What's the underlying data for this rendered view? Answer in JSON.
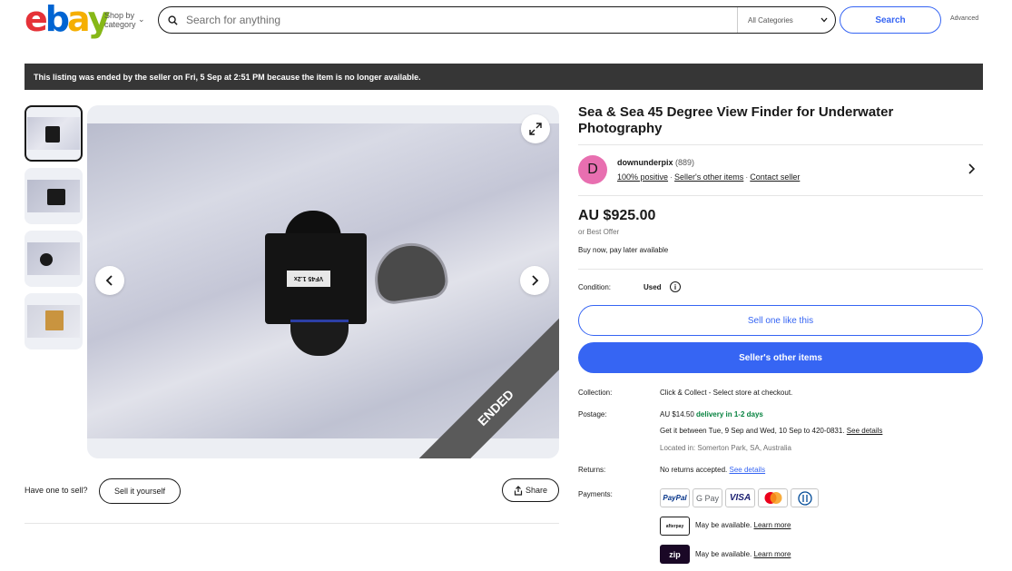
{
  "header": {
    "logo_letters": [
      "e",
      "b",
      "a",
      "y"
    ],
    "shop_by_category": "Shop by category",
    "search_placeholder": "Search for anything",
    "category_select": "All Categories",
    "search_button": "Search",
    "advanced": "Advanced"
  },
  "banner": {
    "text": "This listing was ended by the seller on Fri, 5 Sep at 2:51 PM because the item is no longer available."
  },
  "gallery": {
    "thumbnail_count": 4,
    "selected_index": 0,
    "ended_ribbon": "ENDED",
    "product_label_text": "VF45 1.2x"
  },
  "sell": {
    "have_one": "Have one to sell?",
    "sell_it_yourself": "Sell it yourself",
    "share": "Share"
  },
  "listing": {
    "title": "Sea & Sea 45 Degree View Finder for Underwater Photography",
    "seller": {
      "avatar_letter": "D",
      "name": "downunderpix",
      "feedback_count": "(889)",
      "positive": "100% positive",
      "other_items": "Seller's other items",
      "contact": "Contact seller"
    },
    "price": "AU $925.00",
    "best_offer": "or Best Offer",
    "pay_later": "Buy now, pay later available",
    "condition_label": "Condition:",
    "condition_value": "Used",
    "sell_one_like_this": "Sell one like this",
    "sellers_other_items_button": "Seller's other items",
    "collection_label": "Collection:",
    "collection_value": "Click & Collect - Select store at checkout.",
    "postage_label": "Postage:",
    "postage_price": "AU $14.50",
    "postage_speed": "delivery in 1-2 days",
    "postage_dates": "Get it between Tue, 9 Sep and Wed, 10 Sep to 420-0831.",
    "see_details": "See details",
    "located": "Located in: Somerton Park, SA, Australia",
    "returns_label": "Returns:",
    "returns_value": "No returns accepted.",
    "payments_label": "Payments:",
    "payment_methods": [
      "PayPal",
      "G Pay",
      "VISA",
      "Mastercard",
      "Diners"
    ],
    "afterpay_logo": "afterpay",
    "zip_logo": "zip",
    "may_be_available": "May be available.",
    "learn_more": "Learn more"
  },
  "colors": {
    "accent": "#3665f3",
    "banner_bg": "#363636",
    "green": "#05823f",
    "avatar": "#e86fb0"
  }
}
